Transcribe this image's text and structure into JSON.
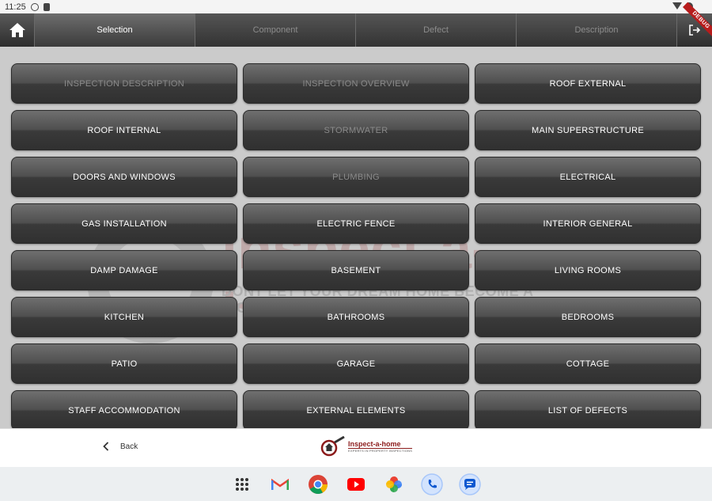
{
  "status_bar": {
    "time": "11:25"
  },
  "debug_ribbon": "DEBUG",
  "tabs": [
    {
      "label": "Selection",
      "active": true
    },
    {
      "label": "Component",
      "active": false
    },
    {
      "label": "Defect",
      "active": false
    },
    {
      "label": "Description",
      "active": false
    }
  ],
  "watermark": {
    "brand": "inspect-a-home",
    "tagline": "DONT LET YOUR DREAM HOME BECOME A NIGHTMARE"
  },
  "categories": [
    {
      "label": "INSPECTION  DESCRIPTION",
      "enabled": false
    },
    {
      "label": "INSPECTION OVERVIEW",
      "enabled": false
    },
    {
      "label": "ROOF EXTERNAL",
      "enabled": true
    },
    {
      "label": "ROOF INTERNAL",
      "enabled": true
    },
    {
      "label": "STORMWATER",
      "enabled": false
    },
    {
      "label": "MAIN SUPERSTRUCTURE",
      "enabled": true
    },
    {
      "label": "DOORS AND WINDOWS",
      "enabled": true
    },
    {
      "label": "PLUMBING",
      "enabled": false
    },
    {
      "label": "ELECTRICAL",
      "enabled": true
    },
    {
      "label": "GAS INSTALLATION",
      "enabled": true
    },
    {
      "label": "ELECTRIC FENCE",
      "enabled": true
    },
    {
      "label": "INTERIOR GENERAL",
      "enabled": true
    },
    {
      "label": "DAMP DAMAGE",
      "enabled": true
    },
    {
      "label": "BASEMENT",
      "enabled": true
    },
    {
      "label": "LIVING ROOMS",
      "enabled": true
    },
    {
      "label": "KITCHEN",
      "enabled": true
    },
    {
      "label": "BATHROOMS",
      "enabled": true
    },
    {
      "label": "BEDROOMS",
      "enabled": true
    },
    {
      "label": "PATIO",
      "enabled": true
    },
    {
      "label": "GARAGE",
      "enabled": true
    },
    {
      "label": "COTTAGE",
      "enabled": true
    },
    {
      "label": "STAFF ACCOMMODATION",
      "enabled": true
    },
    {
      "label": "EXTERNAL ELEMENTS",
      "enabled": true
    },
    {
      "label": "LIST OF DEFECTS",
      "enabled": true
    }
  ],
  "bottom_bar": {
    "back_label": "Back",
    "brand_name": "Inspect-a-home",
    "brand_tagline": "EXPERTS IN PROPERTY INSPECTIONS"
  },
  "taskbar_apps": [
    "apps-grid-icon",
    "gmail-icon",
    "chrome-icon",
    "youtube-icon",
    "photos-icon",
    "phone-icon",
    "messages-icon"
  ],
  "colors": {
    "accent_red": "#8b1a1a",
    "button_dark": "#303030",
    "disabled_text": "#8a8a8a"
  }
}
